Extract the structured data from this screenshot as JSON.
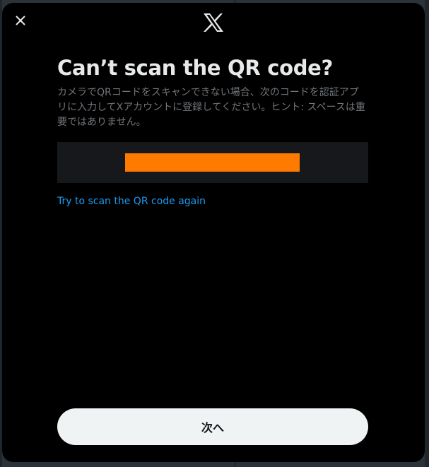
{
  "dialog": {
    "title": "Can’t scan the QR code?",
    "description": "カメラでQRコードをスキャンできない場合、次のコードを認証アプリに入力してXアカウントに登録してください。ヒント: スペースは重要ではありません。",
    "retry_link": "Try to scan the QR code again",
    "next_button": "次へ"
  },
  "icons": {
    "close": "close-icon",
    "logo": "x-logo-icon"
  },
  "colors": {
    "modal_background": "#000000",
    "code_box_background": "#16181c",
    "code_redaction": "#ff7b00",
    "link": "#1d9bf0",
    "title_text": "#e7e9ea",
    "secondary_text": "#71767b",
    "primary_button_background": "#eff3f4",
    "primary_button_text": "#0f1419"
  }
}
